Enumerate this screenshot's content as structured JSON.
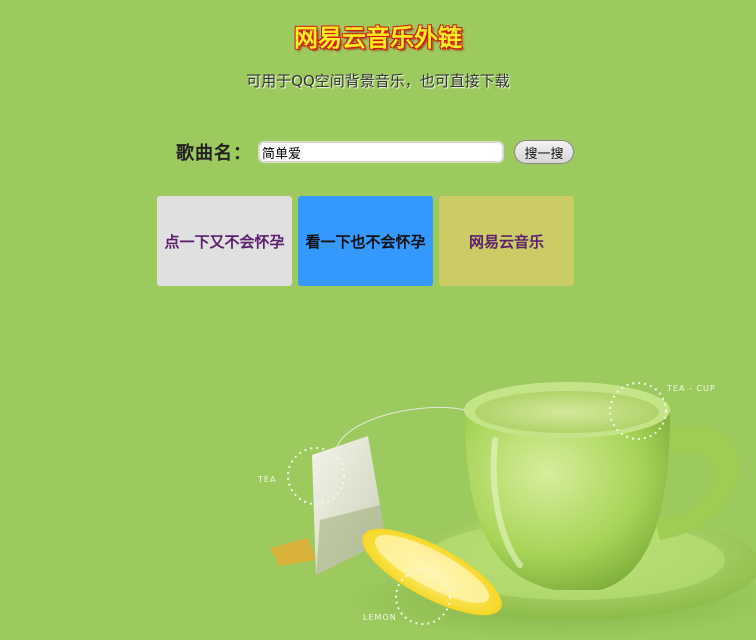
{
  "header": {
    "title": "网易云音乐外链",
    "subtitle": "可用于QQ空间背景音乐，也可直接下载"
  },
  "search": {
    "label": "歌曲名：",
    "value": "简单爱",
    "button_label": "搜一搜"
  },
  "modes": [
    {
      "label": "点一下又不会怀孕",
      "color": "#e0e0e0"
    },
    {
      "label": "看一下也不会怀孕",
      "color": "#3399ff"
    },
    {
      "label": "网易云音乐",
      "color": "#cccc66"
    }
  ],
  "decor": {
    "tea_label": "TEA",
    "cup_label": "TEA - CUP",
    "lemon_label": "LEMON"
  },
  "colors": {
    "background": "#9dca5e",
    "title": "#ffee22",
    "title_outline": "#d21f0f"
  }
}
